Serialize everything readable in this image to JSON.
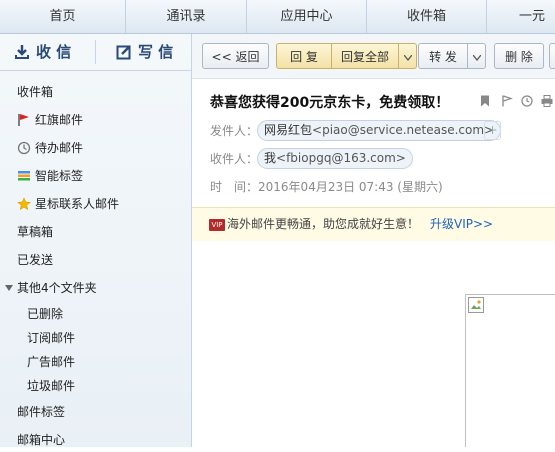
{
  "topnav": {
    "tabs": [
      "首页",
      "通讯录",
      "应用中心",
      "收件箱",
      "一元夺"
    ]
  },
  "sidebar": {
    "receive_label": "收 信",
    "write_label": "写 信",
    "items": {
      "inbox": "收件箱",
      "flagged": "红旗邮件",
      "todo": "待办邮件",
      "smart_tags": "智能标签",
      "starred_contacts": "星标联系人邮件",
      "drafts": "草稿箱",
      "sent": "已发送",
      "other_folders": "其他4个文件夹",
      "deleted": "已删除",
      "subscriptions": "订阅邮件",
      "ads": "广告邮件",
      "spam": "垃圾邮件",
      "mail_tags": "邮件标签",
      "mailbox_center": "邮箱中心"
    }
  },
  "toolbar": {
    "back": "<< 返回",
    "reply": "回 复",
    "reply_all": "回复全部",
    "forward": "转 发",
    "delete": "删 除"
  },
  "email": {
    "subject": "恭喜您获得200元京东卡，免费领取！",
    "from_label": "发件人：",
    "from_name": "网易红包",
    "from_addr": "<piao@service.netease.com>",
    "to_label": "收件人：",
    "to_name": "我",
    "to_addr": "<fbiopgq@163.com>",
    "time_label": "时　间：",
    "time_value": "2016年04月23日 07:43 (星期六)"
  },
  "notice": {
    "badge": "VIP",
    "text": "海外邮件更畅通，助您成就好生意！",
    "link": "升级VIP>>"
  },
  "colors": {
    "flag": "#e02020",
    "star": "#f5b800",
    "link": "#1f63b8"
  }
}
